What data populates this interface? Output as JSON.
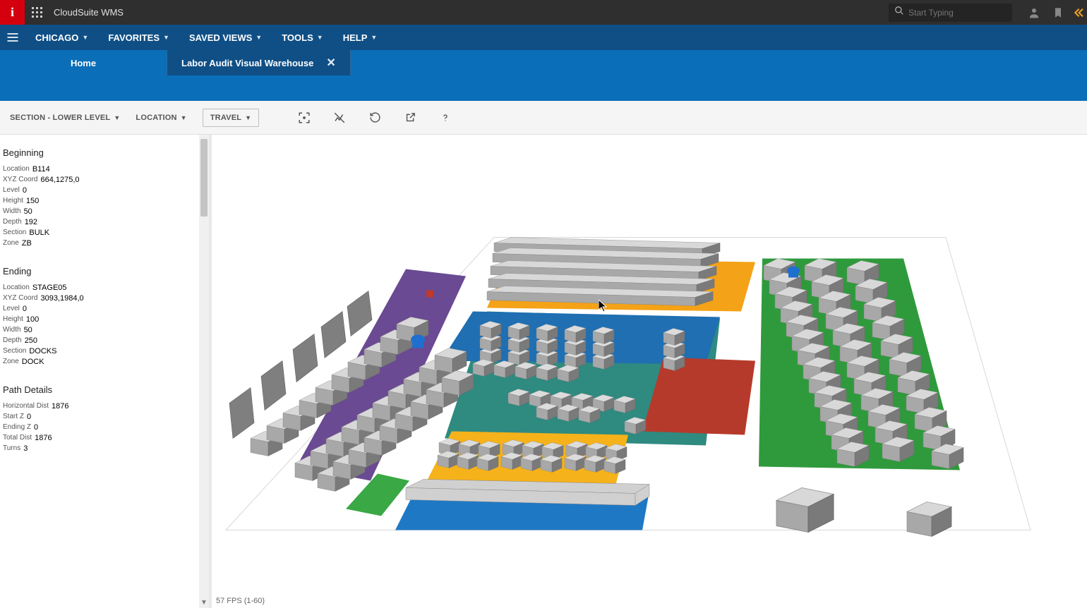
{
  "top": {
    "app_title": "CloudSuite WMS",
    "search_placeholder": "Start Typing"
  },
  "menu": {
    "chicago": "CHICAGO",
    "favorites": "FAVORITES",
    "saved_views": "SAVED VIEWS",
    "tools": "TOOLS",
    "help": "HELP"
  },
  "tabs": {
    "home": "Home",
    "active": "Labor Audit Visual Warehouse"
  },
  "toolbar": {
    "section": "SECTION - LOWER LEVEL",
    "location": "LOCATION",
    "travel": "TRAVEL"
  },
  "side": {
    "beginning_title": "Beginning",
    "beginning": {
      "location_label": "Location",
      "location_value": "B114",
      "xyz_label": "XYZ Coord",
      "xyz_value": "664,1275,0",
      "level_label": "Level",
      "level_value": "0",
      "height_label": "Height",
      "height_value": "150",
      "width_label": "Width",
      "width_value": "50",
      "depth_label": "Depth",
      "depth_value": "192",
      "section_label": "Section",
      "section_value": "BULK",
      "zone_label": "Zone",
      "zone_value": "ZB"
    },
    "ending_title": "Ending",
    "ending": {
      "location_label": "Location",
      "location_value": "STAGE05",
      "xyz_label": "XYZ Coord",
      "xyz_value": "3093,1984,0",
      "level_label": "Level",
      "level_value": "0",
      "height_label": "Height",
      "height_value": "100",
      "width_label": "Width",
      "width_value": "50",
      "depth_label": "Depth",
      "depth_value": "250",
      "section_label": "Section",
      "section_value": "DOCKS",
      "zone_label": "Zone",
      "zone_value": "DOCK"
    },
    "path_title": "Path Details",
    "path": {
      "hdist_label": "Horizontal Dist",
      "hdist_value": "1876",
      "startz_label": "Start Z",
      "startz_value": "0",
      "endz_label": "Ending Z",
      "endz_value": "0",
      "total_label": "Total Dist",
      "total_value": "1876",
      "turns_label": "Turns",
      "turns_value": "3"
    }
  },
  "canvas": {
    "fps": "57 FPS (1-60)"
  }
}
